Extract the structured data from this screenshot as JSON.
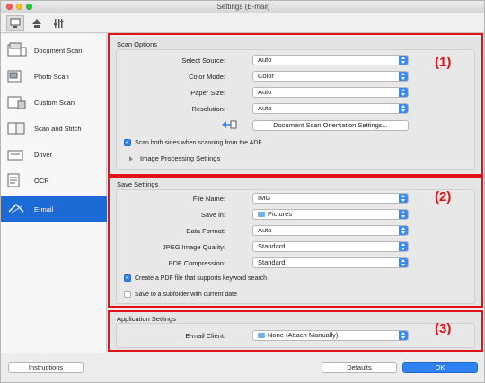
{
  "window": {
    "title": "Settings (E-mail)"
  },
  "toolbar": {
    "tabs": [
      {
        "icon": "scan-from-computer-icon"
      },
      {
        "icon": "scan-from-operation-panel-icon"
      },
      {
        "icon": "general-settings-icon"
      }
    ]
  },
  "sidebar": {
    "items": [
      {
        "label": "Document Scan",
        "icon": "document-scan-icon"
      },
      {
        "label": "Photo Scan",
        "icon": "photo-scan-icon"
      },
      {
        "label": "Custom Scan",
        "icon": "custom-scan-icon"
      },
      {
        "label": "Scan and Stitch",
        "icon": "scan-and-stitch-icon"
      },
      {
        "label": "Driver",
        "icon": "driver-icon"
      },
      {
        "label": "OCR",
        "icon": "ocr-icon"
      },
      {
        "label": "E-mail",
        "icon": "email-icon",
        "selected": true
      }
    ]
  },
  "scan_options": {
    "title": "Scan Options",
    "select_source_label": "Select Source:",
    "select_source_value": "Auto",
    "color_mode_label": "Color Mode:",
    "color_mode_value": "Color",
    "paper_size_label": "Paper Size:",
    "paper_size_value": "Auto",
    "resolution_label": "Resolution:",
    "resolution_value": "Auto",
    "orientation_button": "Document Scan Orientation Settings...",
    "adf_checkbox": "Scan both sides when scanning from the ADF",
    "adf_checked": true,
    "image_processing": "Image Processing Settings"
  },
  "save_settings": {
    "title": "Save Settings",
    "file_name_label": "File Name:",
    "file_name_value": "IMG",
    "save_in_label": "Save in:",
    "save_in_value": "Pictures",
    "data_format_label": "Data Format:",
    "data_format_value": "Auto",
    "jpeg_quality_label": "JPEG Image Quality:",
    "jpeg_quality_value": "Standard",
    "pdf_compression_label": "PDF Compression:",
    "pdf_compression_value": "Standard",
    "keyword_pdf_checkbox": "Create a PDF file that supports keyword search",
    "keyword_pdf_checked": true,
    "subfolder_checkbox": "Save to a subfolder with current date",
    "subfolder_checked": false
  },
  "application_settings": {
    "title": "Application Settings",
    "email_client_label": "E-mail Client:",
    "email_client_value": "None (Attach Manually)"
  },
  "annotations": {
    "one": "(1)",
    "two": "(2)",
    "three": "(3)"
  },
  "footer": {
    "instructions": "Instructions",
    "defaults": "Defaults",
    "ok": "OK"
  },
  "colors": {
    "accent": "#2f82f0",
    "selected": "#1b6ad6",
    "annotation_red": "#e2121b"
  }
}
